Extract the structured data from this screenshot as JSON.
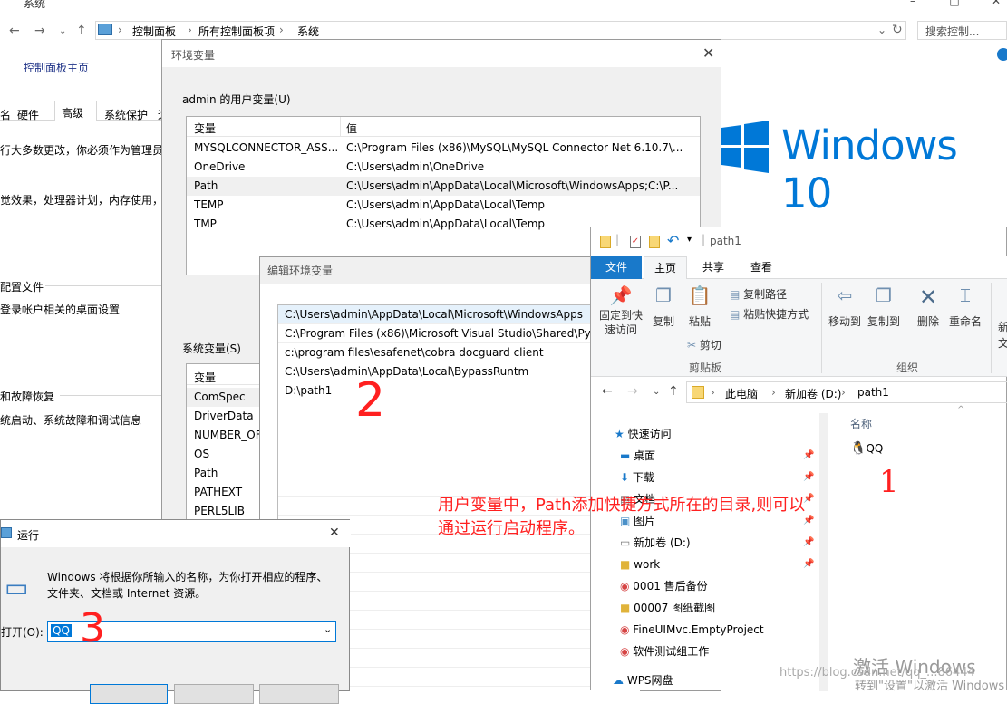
{
  "system_window": {
    "title": "系统",
    "breadcrumb": [
      "控制面板",
      "所有控制面板项",
      "系统"
    ],
    "search_placeholder": "搜索控制..."
  },
  "control_panel_left": {
    "home_label": "控制面板主页",
    "tabs": [
      "名",
      "硬件",
      "高级",
      "系统保护",
      "远"
    ],
    "active_tab": "高级",
    "lines": [
      "行大多数更改，你必须作为管理员登",
      "觉效果，处理器计划，内存使用，以",
      "配置文件",
      "登录帐户相关的桌面设置",
      "和故障恢复",
      "统启动、系统故障和调试信息"
    ]
  },
  "env_dialog": {
    "title": "环境变量",
    "user_group_label": "admin 的用户变量(U)",
    "columns": [
      "变量",
      "值"
    ],
    "user_vars": [
      {
        "name": "MYSQLCONNECTOR_ASS...",
        "value": "C:\\Program Files (x86)\\MySQL\\MySQL Connector Net 6.10.7\\..."
      },
      {
        "name": "OneDrive",
        "value": "C:\\Users\\admin\\OneDrive"
      },
      {
        "name": "Path",
        "value": "C:\\Users\\admin\\AppData\\Local\\Microsoft\\WindowsApps;C:\\P..."
      },
      {
        "name": "TEMP",
        "value": "C:\\Users\\admin\\AppData\\Local\\Temp"
      },
      {
        "name": "TMP",
        "value": "C:\\Users\\admin\\AppData\\Local\\Temp"
      }
    ],
    "system_group_label": "系统变量(S)",
    "system_vars": [
      "ComSpec",
      "DriverData",
      "NUMBER_OF",
      "OS",
      "Path",
      "PATHEXT",
      "PERL5LIB"
    ]
  },
  "edit_dialog": {
    "title": "编辑环境变量",
    "entries": [
      "C:\\Users\\admin\\AppData\\Local\\Microsoft\\WindowsApps",
      "C:\\Program Files (x86)\\Microsoft Visual Studio\\Shared\\Pyth",
      "c:\\program files\\esafenet\\cobra docguard client",
      "C:\\Users\\admin\\AppData\\Local\\BypassRuntm",
      "D:\\path1"
    ]
  },
  "explorer": {
    "title": "path1",
    "ribbon_tabs": [
      "文件",
      "主页",
      "共享",
      "查看"
    ],
    "ribbon_buttons": {
      "pin": "固定到快速访问",
      "copy": "复制",
      "paste": "粘贴",
      "copy_path": "复制路径",
      "paste_shortcut": "粘贴快捷方式",
      "cut": "剪切",
      "move_to": "移动到",
      "copy_to": "复制到",
      "delete": "删除",
      "rename": "重命名",
      "new": "新",
      "new2": "文"
    },
    "group_labels": [
      "剪贴板",
      "组织"
    ],
    "path": [
      "此电脑",
      "新加卷 (D:)",
      "path1"
    ],
    "nav_items": [
      "快速访问",
      "桌面",
      "下载",
      "文档",
      "图片",
      "新加卷 (D:)",
      "work",
      "0001 售后备份",
      "00007 图纸截图",
      "FineUIMvc.EmptyProject",
      "软件测试组工作",
      "WPS网盘"
    ],
    "column_header": "名称",
    "files": [
      "QQ"
    ]
  },
  "run_dialog": {
    "title": "运行",
    "description": "Windows 将根据你所输入的名称，为你打开相应的程序、文件夹、文档或 Internet 资源。",
    "open_label": "打开(O):",
    "input_value": "QQ"
  },
  "branding": {
    "windows_logo_text": "Windows 10",
    "watermark_line1": "激活 Windows",
    "watermark_line2": "转到\"设置\"以激活 Windows",
    "url_watermark": "https://blog.csdn.net/qq_...86444"
  },
  "annotations": {
    "note": "用户变量中，Path添加快捷方式所在的目录,则可以通过运行启动程序。",
    "marks": [
      "1",
      "2",
      "3"
    ]
  },
  "colors": {
    "accent": "#1979ca",
    "win_logo": "#0078d7",
    "annotation": "#ff2020",
    "selection": "#0078d7"
  }
}
